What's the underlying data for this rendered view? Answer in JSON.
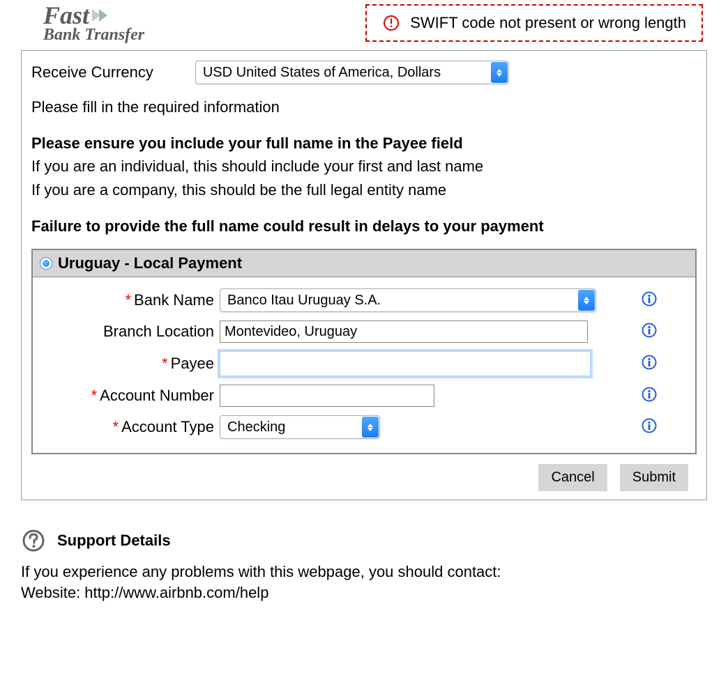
{
  "logo": {
    "line1": "Fast",
    "line2": "Bank Transfer"
  },
  "alert": {
    "text": "SWIFT code not present or wrong length"
  },
  "currency": {
    "label": "Receive Currency",
    "value": "USD United States of America, Dollars"
  },
  "instructions": {
    "line1": "Please fill in the required information",
    "line2": "Please ensure you include your full name in the Payee field",
    "line3": "If you are an individual, this should include your first and last name",
    "line4": "If you are a company, this should be the full legal entity name",
    "line5": "Failure to provide the full name could result in delays to your payment"
  },
  "payment": {
    "title": "Uruguay - Local Payment",
    "fields": {
      "bank_name": {
        "label": "Bank Name",
        "value": "Banco Itau Uruguay S.A.",
        "required": true
      },
      "branch_location": {
        "label": "Branch Location",
        "value": "Montevideo, Uruguay",
        "required": false
      },
      "payee": {
        "label": "Payee",
        "value": "",
        "required": true
      },
      "account_number": {
        "label": "Account Number",
        "value": "",
        "required": true
      },
      "account_type": {
        "label": "Account Type",
        "value": "Checking",
        "required": true
      }
    }
  },
  "buttons": {
    "cancel": "Cancel",
    "submit": "Submit"
  },
  "support": {
    "title": "Support Details",
    "text1": "If you experience any problems with this webpage, you should contact:",
    "text2": "Website: http://www.airbnb.com/help"
  }
}
